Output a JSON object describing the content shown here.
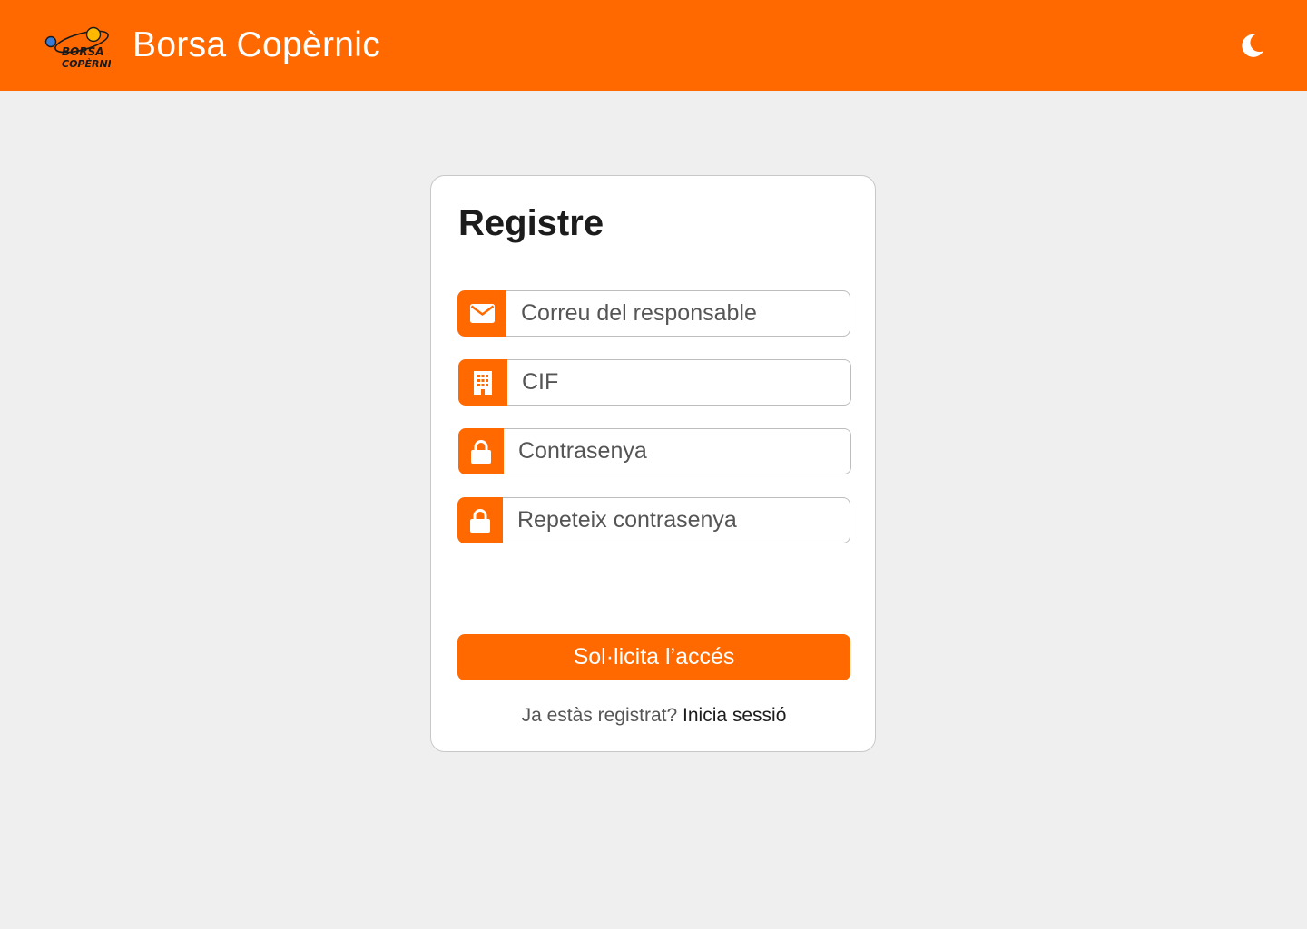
{
  "app": {
    "title": "Borsa Copèrnic",
    "logo_text_line1": "BORSA",
    "logo_text_line2": "COPÈRNIC",
    "theme_toggle_icon": "moon-icon"
  },
  "form": {
    "title": "Registre",
    "fields": [
      {
        "icon": "envelope-icon",
        "placeholder": "Correu del responsable",
        "type": "email"
      },
      {
        "icon": "building-icon",
        "placeholder": "CIF",
        "type": "text"
      },
      {
        "icon": "lock-icon",
        "placeholder": "Contrasenya",
        "type": "password"
      },
      {
        "icon": "lock-icon",
        "placeholder": "Repeteix contrasenya",
        "type": "password"
      }
    ],
    "submit_label": "Sol·licita l’accés",
    "footer_prompt": "Ja estàs registrat?",
    "footer_link": "Inicia sessió"
  },
  "colors": {
    "accent": "#ff6900",
    "background": "#efefef",
    "card": "#ffffff"
  }
}
